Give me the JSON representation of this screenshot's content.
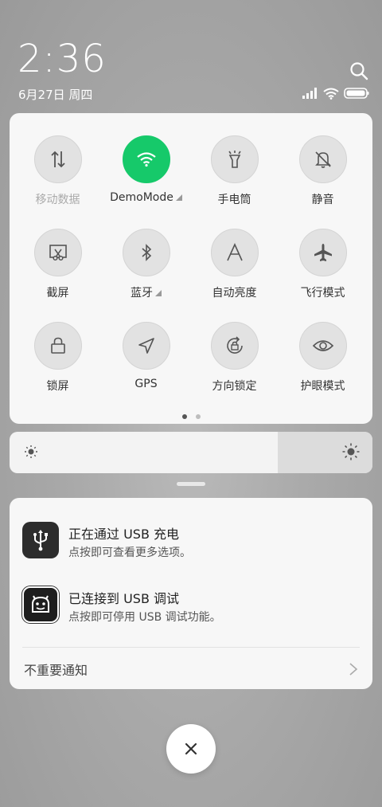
{
  "status": {
    "time": "2:36",
    "date": "6月27日 周四"
  },
  "quick_settings": {
    "tiles": [
      {
        "label": "移动数据",
        "icon": "mobile-data-icon",
        "active": false,
        "dim": true
      },
      {
        "label": "DemoMode",
        "icon": "wifi-icon",
        "active": true,
        "expandable": true
      },
      {
        "label": "手电筒",
        "icon": "flashlight-icon",
        "active": false
      },
      {
        "label": "静音",
        "icon": "mute-bell-icon",
        "active": false
      },
      {
        "label": "截屏",
        "icon": "screenshot-icon",
        "active": false
      },
      {
        "label": "蓝牙",
        "icon": "bluetooth-icon",
        "active": false,
        "expandable": true
      },
      {
        "label": "自动亮度",
        "icon": "auto-brightness-icon",
        "active": false
      },
      {
        "label": "飞行模式",
        "icon": "airplane-icon",
        "active": false
      },
      {
        "label": "锁屏",
        "icon": "lock-icon",
        "active": false
      },
      {
        "label": "GPS",
        "icon": "gps-icon",
        "active": false
      },
      {
        "label": "方向锁定",
        "icon": "rotation-lock-icon",
        "active": false
      },
      {
        "label": "护眼模式",
        "icon": "eye-icon",
        "active": false
      }
    ],
    "page_count": 2,
    "current_page": 1,
    "active_color": "#16c96a"
  },
  "brightness": {
    "level": 0.74
  },
  "notifications": {
    "items": [
      {
        "title": "正在通过 USB 充电",
        "subtitle": "点按即可查看更多选项。",
        "icon": "usb-icon"
      },
      {
        "title": "已连接到 USB 调试",
        "subtitle": "点按即可停用 USB 调试功能。",
        "icon": "android-debug-icon"
      }
    ],
    "unimportant_label": "不重要通知"
  }
}
